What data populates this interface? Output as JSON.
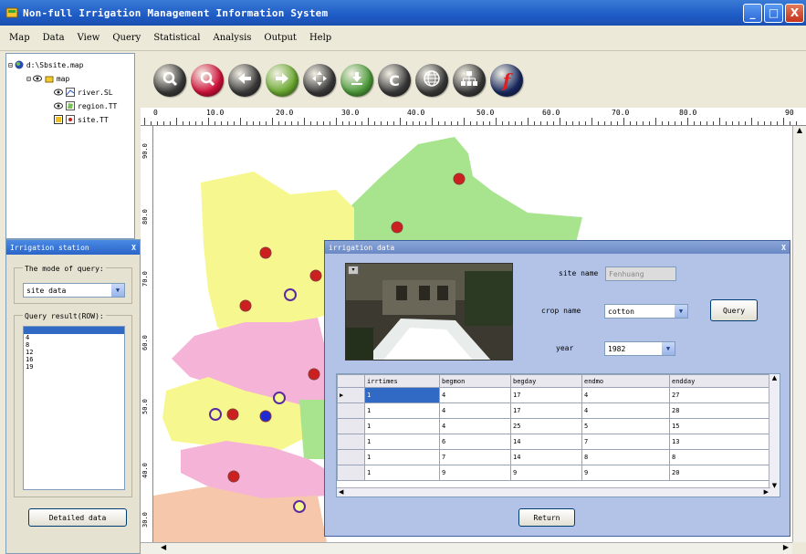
{
  "window": {
    "title": "Non-full Irrigation Management Information System",
    "controls": [
      "_",
      "□",
      "X"
    ]
  },
  "menu": [
    "Map",
    "Data",
    "View",
    "Query",
    "Statistical",
    "Analysis",
    "Output",
    "Help"
  ],
  "tree": {
    "root": "d:\\Sbsite.map",
    "group": "map",
    "layers": [
      "river.SL",
      "region.TT",
      "site.TT"
    ]
  },
  "toolbar": {
    "buttons": [
      {
        "icon": "zoom-in-icon",
        "color": "#3a3a3a"
      },
      {
        "icon": "zoom-out-icon",
        "color": "#d0103a"
      },
      {
        "icon": "back-arrow-icon",
        "color": "#3a3a3a"
      },
      {
        "icon": "forward-arrow-icon",
        "color": "#6aa830"
      },
      {
        "icon": "pan-icon",
        "color": "#3a3a3a"
      },
      {
        "icon": "download-icon",
        "color": "#4c9a3a"
      },
      {
        "icon": "refresh-icon",
        "color": "#3a3a3a"
      },
      {
        "icon": "globe-icon",
        "color": "#3a3a3a"
      },
      {
        "icon": "network-icon",
        "color": "#3a3a3a"
      },
      {
        "icon": "flash-icon",
        "color": "#1a2a60"
      }
    ]
  },
  "ruler": {
    "h_labels": [
      "0",
      "10.0",
      "20.0",
      "30.0",
      "40.0",
      "50.0",
      "60.0",
      "70.0",
      "80.0",
      "90"
    ],
    "v_labels": [
      "90.0",
      "80.0",
      "70.0",
      "60.0",
      "50.0",
      "40.0",
      "30.0",
      "20.0"
    ]
  },
  "irrigation_panel": {
    "title": "Irrigation station",
    "close": "X",
    "mode_label": "The mode of query:",
    "mode_value": "site data",
    "result_label": "Query result(ROW):",
    "results": [
      "4",
      "8",
      "12",
      "16",
      "19"
    ],
    "detailed_button": "Detailed data"
  },
  "dialog": {
    "title": "irrigation data",
    "close": "X",
    "site_name_label": "site name",
    "site_name_value": "Fenhuang",
    "crop_name_label": "crop name",
    "crop_name_value": "cotton",
    "year_label": "year",
    "year_value": "1982",
    "query_button": "Query",
    "return_button": "Return",
    "table": {
      "columns": [
        "irrtimes",
        "begmon",
        "begday",
        "endmo",
        "endday"
      ],
      "rows": [
        [
          "1",
          "4",
          "17",
          "4",
          "27"
        ],
        [
          "1",
          "4",
          "17",
          "4",
          "28"
        ],
        [
          "1",
          "4",
          "25",
          "5",
          "15"
        ],
        [
          "1",
          "6",
          "14",
          "7",
          "13"
        ],
        [
          "1",
          "7",
          "14",
          "8",
          "8"
        ],
        [
          "1",
          "9",
          "9",
          "9",
          "20"
        ]
      ]
    }
  },
  "colors": {
    "yellow_region": "#f7f78f",
    "green_region": "#a8e48e",
    "pink_region": "#f5b3d7",
    "peach_region": "#f6c7aa",
    "station_red": "#cc2020",
    "station_blue": "#1d2bd0"
  }
}
